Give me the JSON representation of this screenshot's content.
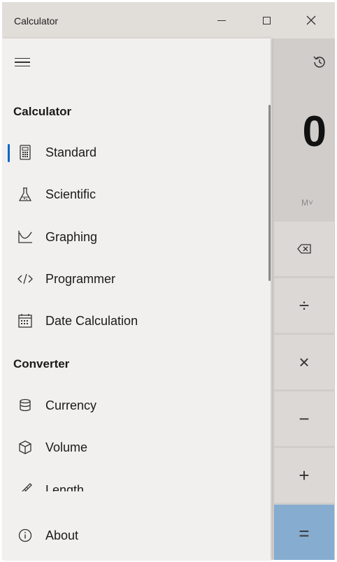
{
  "window": {
    "title": "Calculator"
  },
  "display": {
    "value": "0",
    "memory_label": "M˅"
  },
  "operators": {
    "backspace": "⌫",
    "divide": "÷",
    "multiply": "×",
    "subtract": "−",
    "add": "+",
    "equals": "="
  },
  "nav": {
    "calculator_header": "Calculator",
    "converter_header": "Converter",
    "calculator_items": [
      {
        "label": "Standard",
        "icon": "calculator-icon",
        "selected": true
      },
      {
        "label": "Scientific",
        "icon": "flask-icon",
        "selected": false
      },
      {
        "label": "Graphing",
        "icon": "graph-icon",
        "selected": false
      },
      {
        "label": "Programmer",
        "icon": "code-icon",
        "selected": false
      },
      {
        "label": "Date Calculation",
        "icon": "calendar-icon",
        "selected": false
      }
    ],
    "converter_items": [
      {
        "label": "Currency",
        "icon": "currency-icon"
      },
      {
        "label": "Volume",
        "icon": "cube-icon"
      },
      {
        "label": "Length",
        "icon": "ruler-icon"
      }
    ],
    "about": {
      "label": "About",
      "icon": "info-icon"
    }
  },
  "colors": {
    "accent": "#0a67c8",
    "equals_button": "#86acd0",
    "nav_background": "#f1f0ee"
  }
}
